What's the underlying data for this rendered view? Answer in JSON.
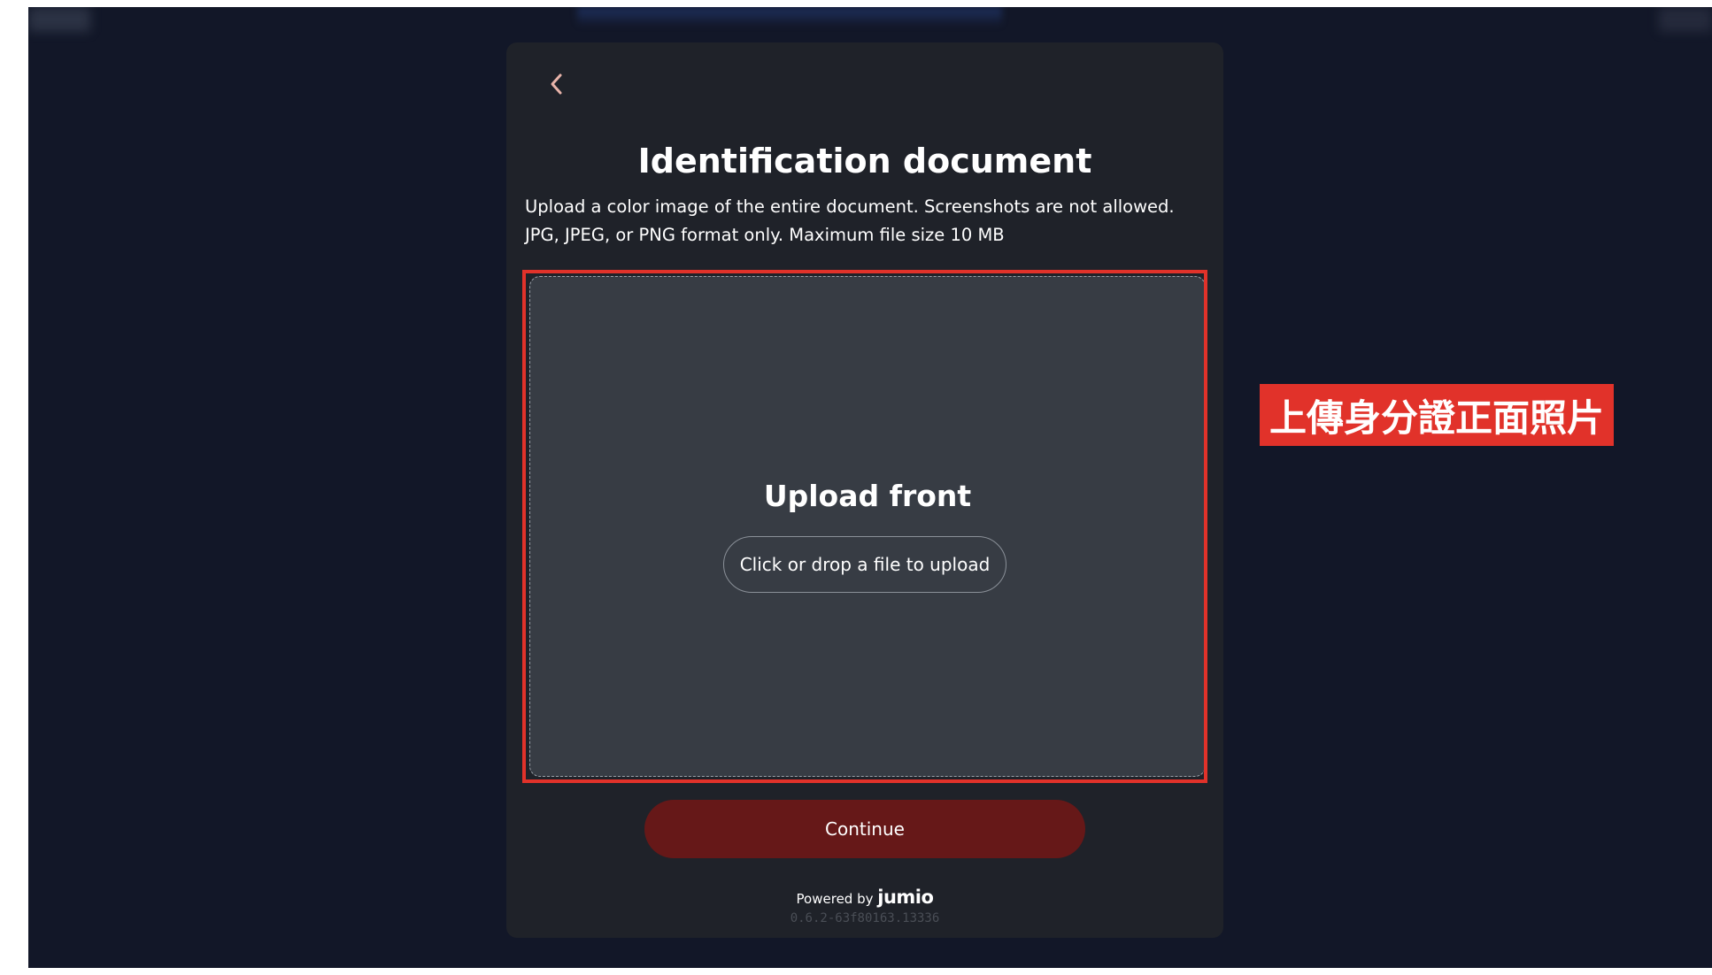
{
  "header": {
    "back_icon": "chevron-left-icon",
    "title": "Identification document"
  },
  "instructions": {
    "line1": "Upload a color image of the entire document. Screenshots are not allowed.",
    "line2": "JPG, JPEG, or PNG format only. Maximum file size 10 MB"
  },
  "upload": {
    "title": "Upload front",
    "button_label": "Click or drop a file to upload"
  },
  "actions": {
    "continue_label": "Continue"
  },
  "footer": {
    "powered_by": "Powered by",
    "brand": "jumio",
    "version": "0.6.2-63f80163.13336"
  },
  "annotation": {
    "label": "上傳身分證正面照片"
  },
  "colors": {
    "page_background": "#121728",
    "modal_background": "#1f2229",
    "upload_zone": "#373c44",
    "continue_button": "#661818",
    "highlight": "#e1322a",
    "back_arrow": "#e8b4aa"
  }
}
